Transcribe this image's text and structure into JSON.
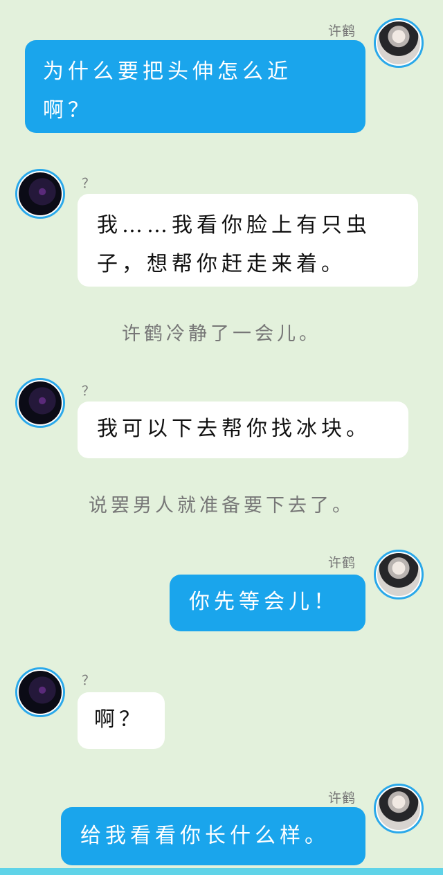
{
  "messages": [
    {
      "sender": "许鹤",
      "side": "right",
      "text": "为什么要把头伸怎么近\n啊？",
      "avatar": "hero-avatar"
    },
    {
      "sender": "？",
      "side": "left",
      "text": "我……我看你脸上有只虫\n子，想帮你赶走来着。",
      "avatar": "dark-avatar"
    },
    {
      "narration": "许鹤冷静了一会儿。"
    },
    {
      "sender": "？",
      "side": "left",
      "text": "我可以下去帮你找冰块。",
      "avatar": "dark-avatar"
    },
    {
      "narration": "说罢男人就准备要下去了。"
    },
    {
      "sender": "许鹤",
      "side": "right",
      "text": "你先等会儿！",
      "avatar": "hero-avatar"
    },
    {
      "sender": "？",
      "side": "left",
      "text": "啊？",
      "avatar": "dark-avatar"
    },
    {
      "sender": "许鹤",
      "side": "right",
      "text": "给我看看你长什么样。",
      "avatar": "hero-avatar"
    }
  ],
  "colors": {
    "background": "#e3f1dc",
    "right_bubble": "#1aa5ec",
    "left_bubble": "#ffffff",
    "avatar_ring": "#2aa8ea",
    "bottom_bar": "#5fd3e8"
  }
}
